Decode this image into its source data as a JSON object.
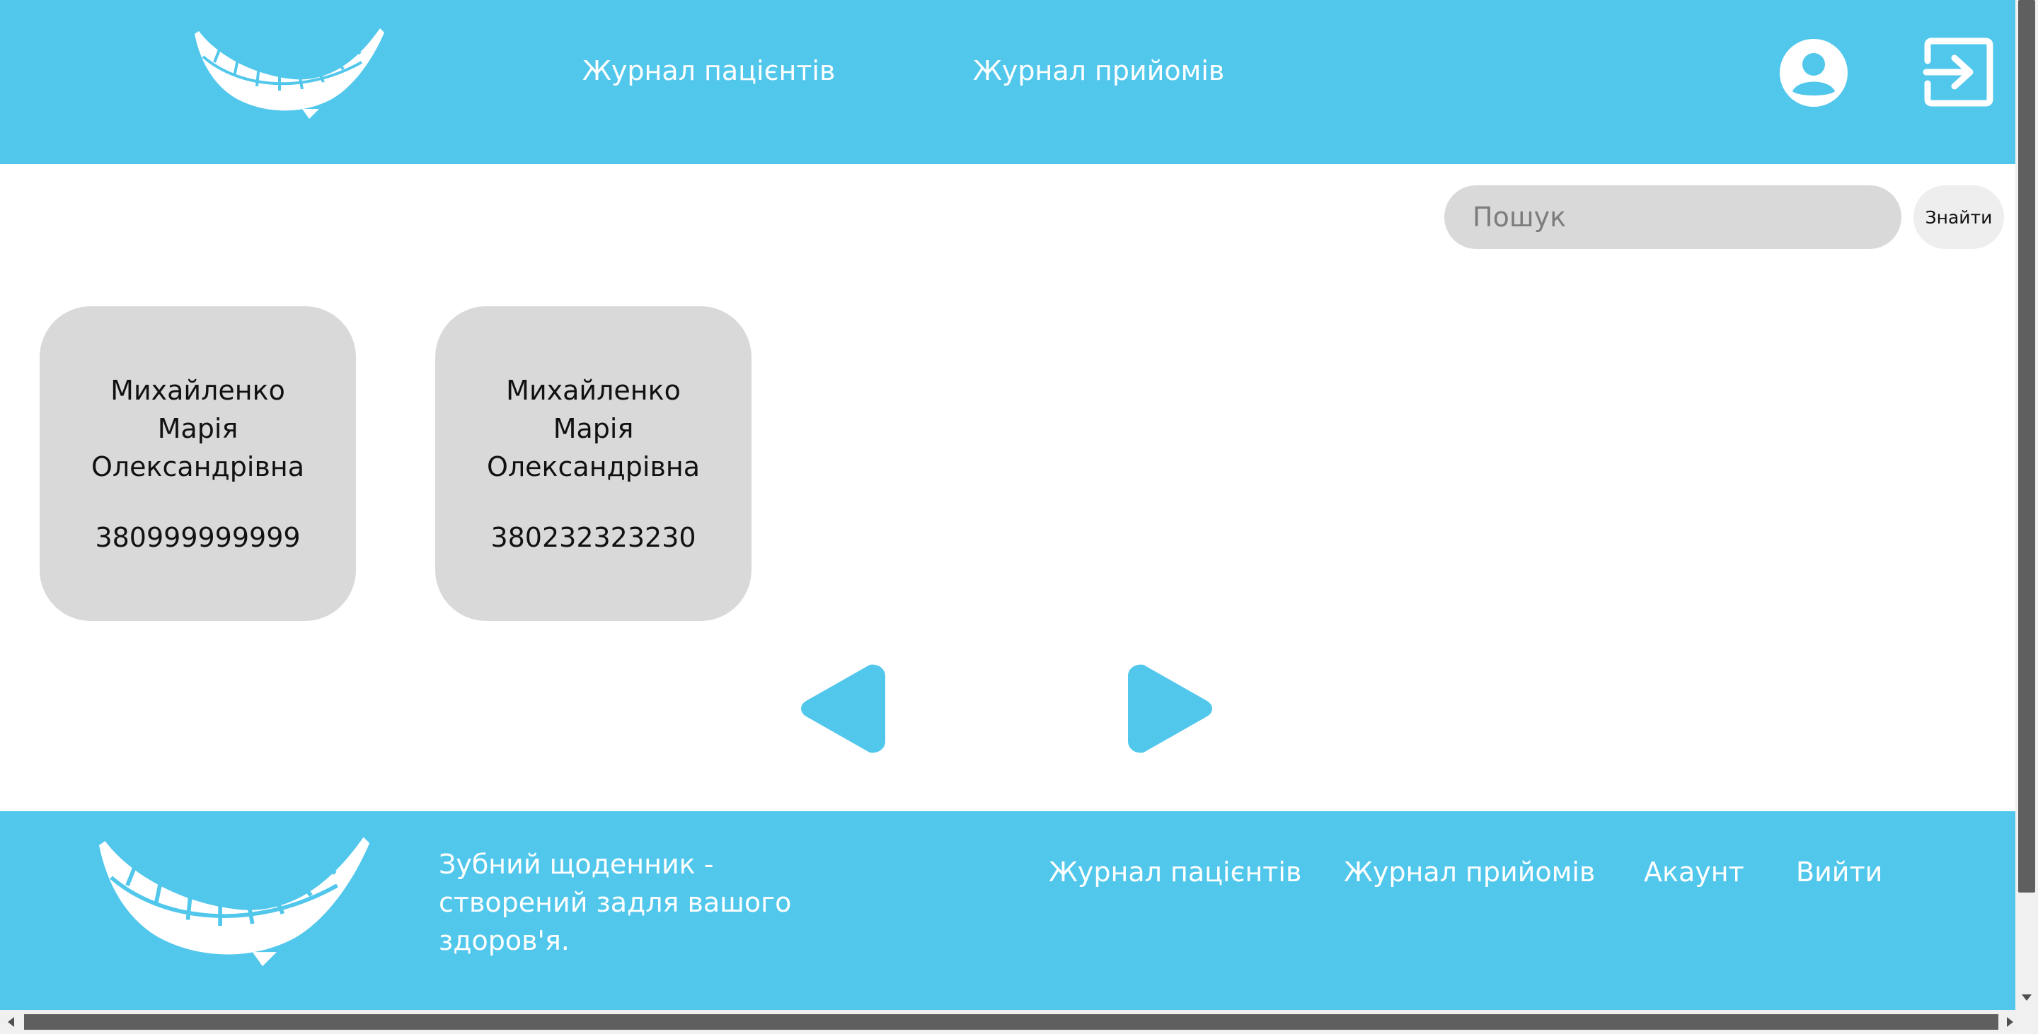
{
  "colors": {
    "brand": "#52c7ec",
    "card_bg": "#d9d9d9",
    "search_bg": "#d9d9d9",
    "button_bg": "#eeeeee",
    "text_dark": "#111111",
    "text_light": "#ffffff"
  },
  "header": {
    "logo_icon": "teeth-smile-logo",
    "nav": [
      {
        "label": "Журнал пацієнтів"
      },
      {
        "label": "Журнал прийомів"
      }
    ],
    "account_icon": "user-circle-icon",
    "logout_icon": "logout-arrow-icon"
  },
  "search": {
    "placeholder": "Пошук",
    "value": "",
    "button_label": "Знайти"
  },
  "patients": [
    {
      "name": "Михайленко\nМарія\nОлександрівна",
      "phone": "380999999999"
    },
    {
      "name": "Михайленко\nМарія\nОлександрівна",
      "phone": "380232323230"
    }
  ],
  "pagination": {
    "prev_icon": "triangle-left-icon",
    "next_icon": "triangle-right-icon"
  },
  "footer": {
    "logo_icon": "teeth-smile-logo",
    "tagline": "Зубний щоденник - створений задля вашого здоров'я.",
    "nav": [
      {
        "label": "Журнал пацієнтів"
      },
      {
        "label": "Журнал прийомів"
      },
      {
        "label": "Акаунт"
      },
      {
        "label": "Вийти"
      }
    ]
  }
}
